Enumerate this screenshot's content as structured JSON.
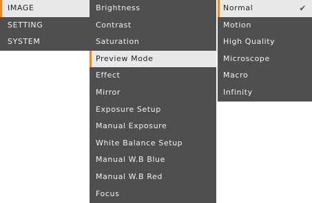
{
  "main_menu": {
    "items": [
      "IMAGE",
      "SETTING",
      "SYSTEM"
    ]
  },
  "image_menu": {
    "items": [
      "Brightness",
      "Contrast",
      "Saturation",
      "Preview Mode",
      "Effect",
      "Mirror",
      "Exposure Setup",
      "Manual Exposure",
      "White Balance Setup",
      "Manual W.B Blue",
      "Manual W.B Red",
      "Focus"
    ]
  },
  "preview_mode_menu": {
    "items": [
      "Normal",
      "Motion",
      "High Quality",
      "Microscope",
      "Macro",
      "Infinity"
    ],
    "check_mark": "✔"
  },
  "colors": {
    "menu_bg": "#4f4f52",
    "selected_bg": "#e8e8e8",
    "accent": "#e8872d",
    "text": "#f2f2f2"
  },
  "icons": {
    "selected_indicator": "check-icon"
  }
}
